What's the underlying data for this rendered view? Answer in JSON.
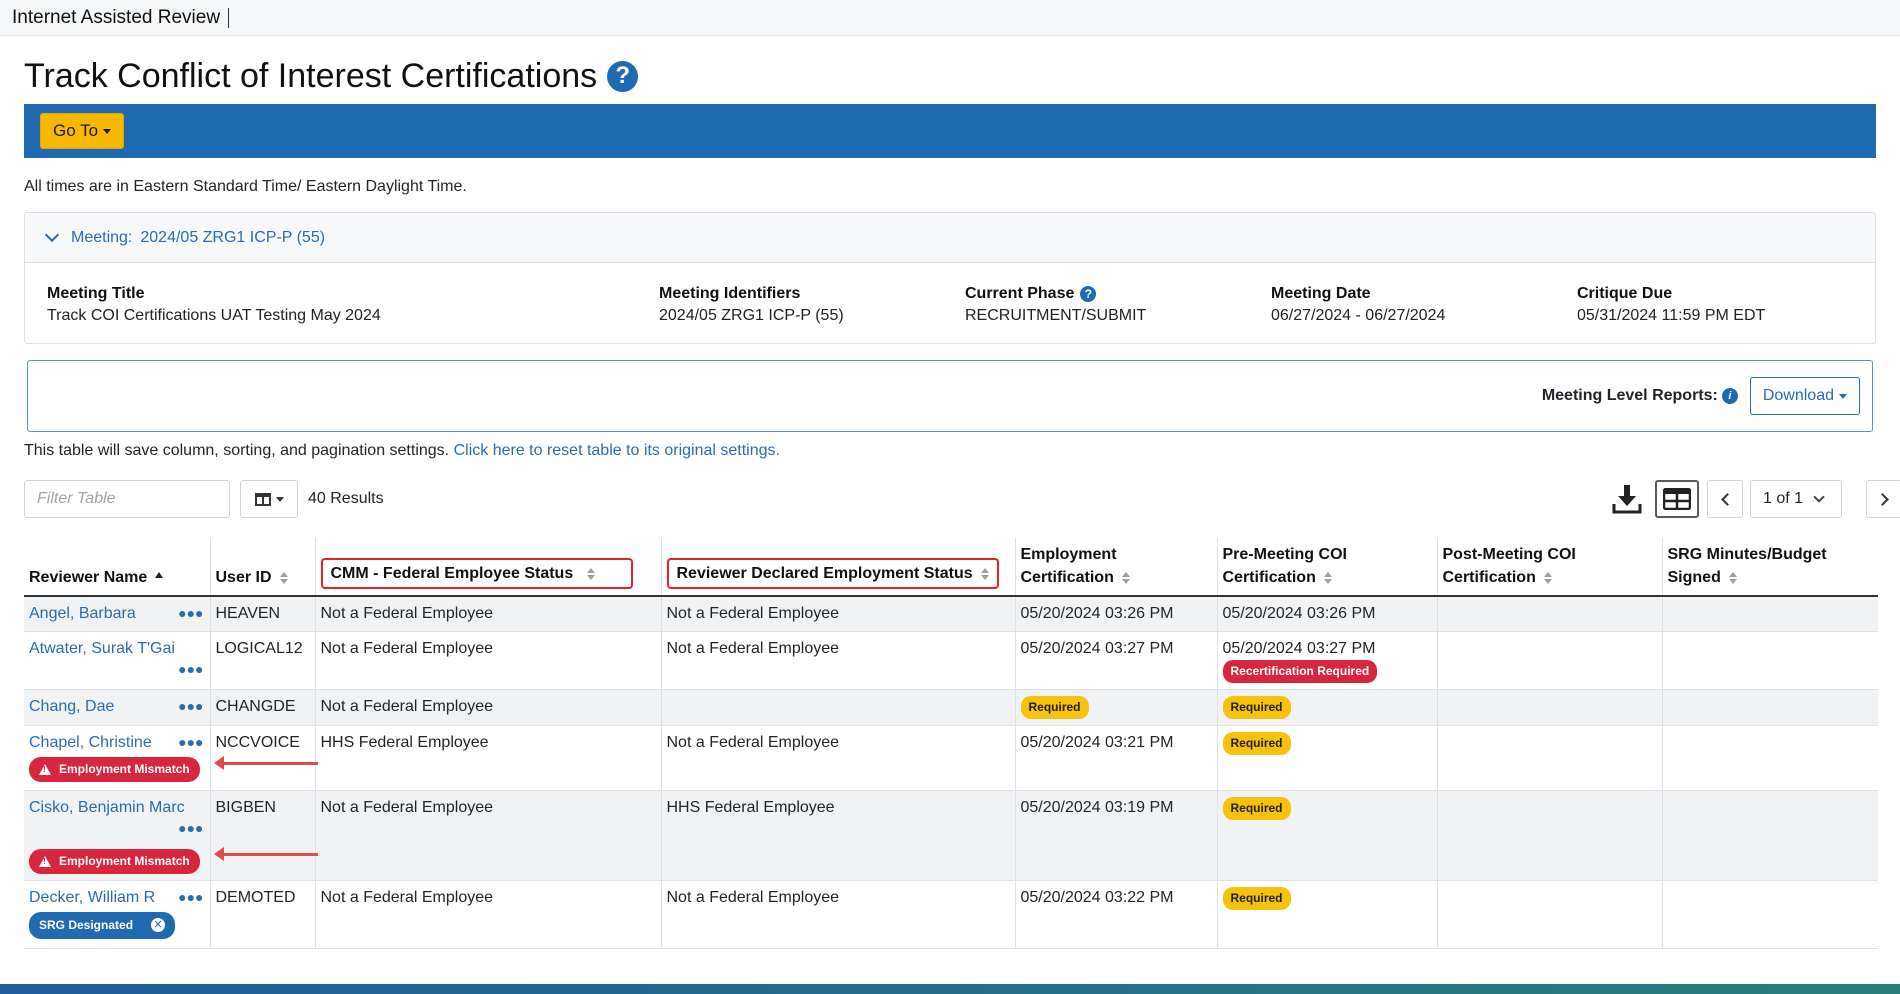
{
  "app": {
    "title": "Internet Assisted Review"
  },
  "page": {
    "title": "Track Conflict of Interest Certifications",
    "help_icon": "question-circle-icon"
  },
  "nav": {
    "goto_label": "Go To"
  },
  "timezone_note": "All times are in Eastern Standard Time/ Eastern Daylight Time.",
  "meeting": {
    "header_label": "Meeting:",
    "header_value": "2024/05 ZRG1 ICP-P (55)",
    "fields": {
      "title_label": "Meeting Title",
      "title_value": "Track COI Certifications UAT Testing May 2024",
      "identifiers_label": "Meeting Identifiers",
      "identifiers_value": "2024/05 ZRG1 ICP-P (55)",
      "phase_label": "Current Phase",
      "phase_value": "RECRUITMENT/SUBMIT",
      "date_label": "Meeting Date",
      "date_value": "06/27/2024 - 06/27/2024",
      "critique_label": "Critique Due",
      "critique_value": "05/31/2024 11:59 PM EDT"
    }
  },
  "reports": {
    "label": "Meeting Level Reports:",
    "download_label": "Download"
  },
  "table_note": {
    "text": "This table will save column, sorting, and pagination settings.",
    "reset_link": "Click here to reset table to its original settings."
  },
  "toolbar": {
    "filter_placeholder": "Filter Table",
    "results": "40 Results",
    "pagination": "1 of 1"
  },
  "columns": {
    "reviewer_name": "Reviewer Name",
    "user_id": "User ID",
    "cmm_status": "CMM - Federal Employee Status",
    "declared_status": "Reviewer Declared Employment Status",
    "employment_cert_1": "Employment",
    "employment_cert_2": "Certification",
    "pre_meeting_1": "Pre-Meeting COI",
    "pre_meeting_2": "Certification",
    "post_meeting_1": "Post-Meeting COI",
    "post_meeting_2": "Certification",
    "srg_1": "SRG Minutes/Budget",
    "srg_2": "Signed"
  },
  "rows": [
    {
      "name": "Angel, Barbara",
      "user_id": "HEAVEN",
      "cmm": "Not a Federal Employee",
      "declared": "Not a Federal Employee",
      "emp_cert": "05/20/2024 03:26 PM",
      "pre_cert": "05/20/2024 03:26 PM"
    },
    {
      "name": "Atwater, Surak T'Gai",
      "user_id": "LOGICAL12",
      "cmm": "Not a Federal Employee",
      "declared": "Not a Federal Employee",
      "emp_cert": "05/20/2024 03:27 PM",
      "pre_cert": "05/20/2024 03:27 PM",
      "pre_badge": "Recertification Required"
    },
    {
      "name": "Chang, Dae",
      "user_id": "CHANGDE",
      "cmm": "Not a Federal Employee",
      "declared": "",
      "emp_badge": "Required",
      "pre_badge": "Required"
    },
    {
      "name": "Chapel, Christine",
      "user_id": "NCCVOICE",
      "cmm": "HHS Federal Employee",
      "declared": "Not a Federal Employee",
      "emp_cert": "05/20/2024 03:21 PM",
      "pre_badge": "Required",
      "name_badge": "Employment Mismatch"
    },
    {
      "name": "Cisko, Benjamin Marc",
      "user_id": "BIGBEN",
      "cmm": "Not a Federal Employee",
      "declared": "HHS Federal Employee",
      "emp_cert": "05/20/2024 03:19 PM",
      "pre_badge": "Required",
      "name_badge": "Employment Mismatch"
    },
    {
      "name": "Decker, William R",
      "user_id": "DEMOTED",
      "cmm": "Not a Federal Employee",
      "declared": "Not a Federal Employee",
      "emp_cert": "05/20/2024 03:22 PM",
      "pre_badge": "Required",
      "name_badge": "SRG Designated"
    }
  ],
  "colors": {
    "brand_blue": "#1f6ab0",
    "accent_yellow": "#f6b800",
    "danger_red": "#d7263d",
    "highlight_red": "#e02424"
  }
}
